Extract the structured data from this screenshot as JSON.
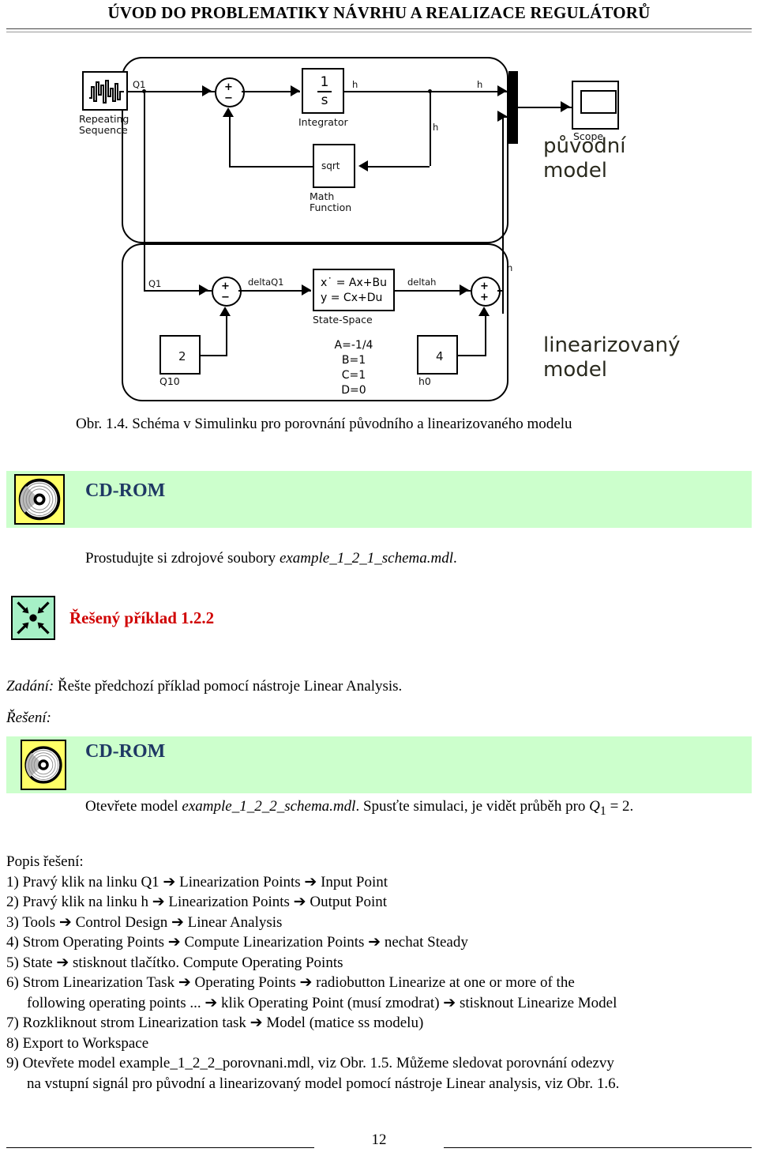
{
  "header": {
    "title": "ÚVOD DO PROBLEMATIKY NÁVRHU A REALIZACE REGULÁTORŮ"
  },
  "figure": {
    "caption": "Obr. 1.4. Schéma v Simulinku pro porovnání původního a linearizovaného modelu",
    "annotations": {
      "original_model": "původní\nmodel",
      "linearized_model": "linearizovaný\nmodel"
    },
    "blocks": {
      "repeating_sequence": "Repeating\nSequence",
      "integrator_label": "Integrator",
      "integrator_num": "1",
      "integrator_den": "s",
      "math_function_label": "Math\nFunction",
      "math_function_op": "sqrt",
      "scope": "Scope",
      "state_space_label": "State-Space",
      "state_space_eq": "x˙ = Ax+Bu\ny = Cx+Du",
      "state_space_params": "A=-1/4\nB=1\nC=1\nD=0",
      "q10_value": "2",
      "q10_label": "Q10",
      "h0_value": "4",
      "h0_label": "h0"
    },
    "signals": {
      "q1_top": "Q1",
      "q1_bottom": "Q1",
      "h_integrator_out": "h",
      "h_feedback": "h",
      "h_mux": "h",
      "h_lin_out": "h",
      "delta_q1": "deltaQ1",
      "delta_h": "deltah"
    },
    "sum_signs": {
      "top_plus": "+",
      "top_minus": "−",
      "left_plus": "+",
      "left_minus": "−",
      "right_plus_1": "+",
      "right_plus_2": "+"
    }
  },
  "cdrom_1": {
    "title": "CD-ROM",
    "icon": "cdrom-icon",
    "text_prefix": "Prostudujte si zdrojové soubory ",
    "text_file": "example_1_2_1_schema.mdl",
    "text_suffix": "."
  },
  "example": {
    "icon": "converging-arrows-icon",
    "title": "Řešený příklad 1.2.2",
    "assignment_label": "Zadání:",
    "assignment_text": " Řešte předchozí příklad pomocí nástroje Linear Analysis.",
    "solution_label": "Řešení:"
  },
  "cdrom_2": {
    "title": "CD-ROM",
    "icon": "cdrom-icon",
    "text_prefix": "Otevřete model ",
    "text_file": "example_1_2_2_schema.mdl",
    "text_suffix": ". Spusťte simulaci, je vidět průběh pro ",
    "text_var": "Q",
    "text_sub": "1",
    "text_end": " = 2."
  },
  "solution": {
    "heading": "Popis řešení:",
    "arrow": "➔",
    "steps": [
      {
        "num": "1)",
        "text": "Pravý klik na linku Q1 ➔ Linearization Points ➔ Input Point"
      },
      {
        "num": "2)",
        "text": "Pravý klik na linku h ➔ Linearization Points ➔ Output Point"
      },
      {
        "num": "3)",
        "text": "Tools ➔ Control Design ➔ Linear Analysis"
      },
      {
        "num": "4)",
        "text": "Strom Operating Points ➔ Compute Linearization Points ➔ nechat Steady"
      },
      {
        "num": "5)",
        "text": "State ➔ stisknout tlačítko. Compute Operating Points"
      },
      {
        "num": "6)",
        "text": "Strom Linearization Task ➔ Operating Points ➔ radiobutton Linearize at one or more of the"
      },
      {
        "num": "",
        "text": "following operating points ... ➔ klik Operating Point (musí zmodrat) ➔ stisknout Linearize Model",
        "continuation": true
      },
      {
        "num": "7)",
        "text": "Rozkliknout strom Linearization task ➔ Model (matice ss modelu)"
      },
      {
        "num": "8)",
        "text": "Export to Workspace"
      },
      {
        "num": "9)",
        "text": "Otevřete model example_1_2_2_porovnani.mdl, viz Obr. 1.5. Můžeme sledovat porovnání odezvy"
      },
      {
        "num": "",
        "text": "na vstupní signál pro původní a linearizovaný model pomocí nástroje Linear analysis, viz Obr. 1.6.",
        "continuation": true
      }
    ]
  },
  "footer": {
    "page_number": "12"
  },
  "colors": {
    "band_green": "#ccffcc",
    "cd_yellow": "#ffff66",
    "cd_title_navy": "#1f3864",
    "example_red": "#d00000",
    "example_icon_green": "#a6f0c6"
  }
}
